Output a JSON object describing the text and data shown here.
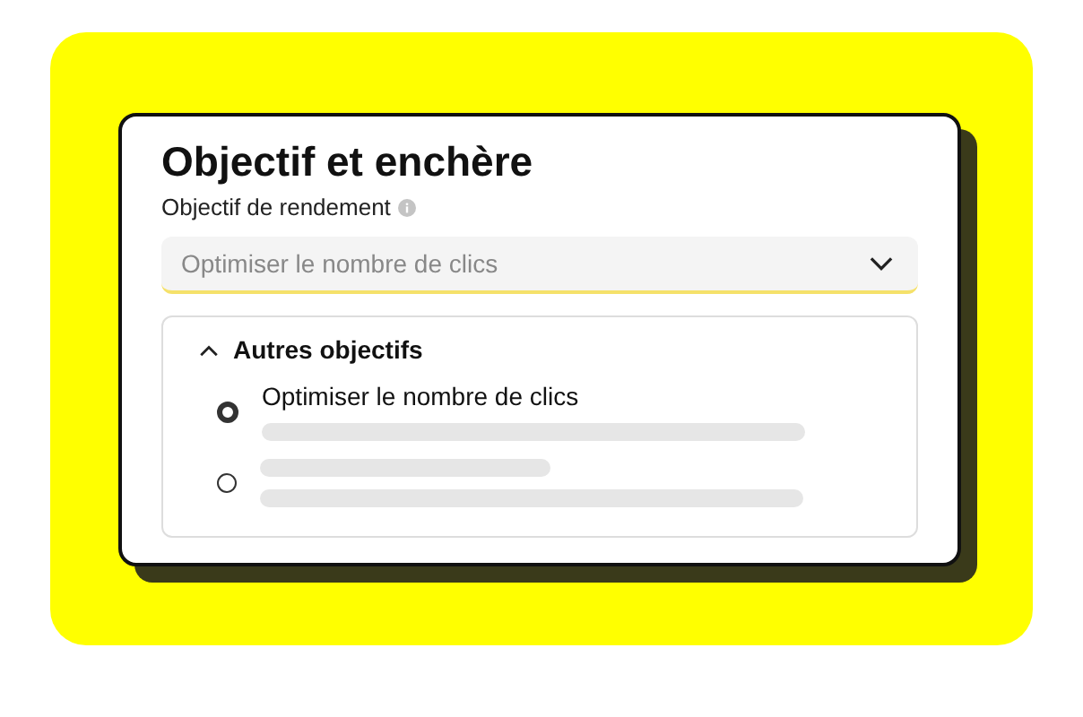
{
  "card": {
    "title": "Objectif et enchère",
    "field_label": "Objectif de rendement",
    "dropdown": {
      "value": "Optimiser le nombre de clics"
    },
    "section": {
      "title": "Autres objectifs",
      "expanded": true,
      "options": [
        {
          "kind": "labeled",
          "label": "Optimiser le nombre de clics",
          "selected": true
        },
        {
          "kind": "skeleton",
          "selected": false
        }
      ]
    }
  }
}
